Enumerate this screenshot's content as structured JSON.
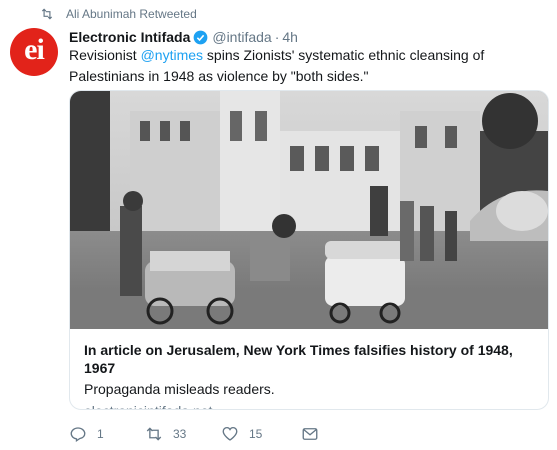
{
  "retweet_context": {
    "text": "Ali Abunimah Retweeted",
    "icon": "retweet-icon"
  },
  "author": {
    "avatar_text": "ei",
    "avatar_color": "#e2231a",
    "name": "Electronic Intifada",
    "verified": true,
    "handle": "@intifada",
    "separator": "·",
    "time": "4h"
  },
  "tweet": {
    "text_before": "Revisionist ",
    "mention": "@nytimes",
    "text_after": " spins Zionists' systematic ethnic cleansing of Palestinians in 1948 as violence by \"both sides.\""
  },
  "card": {
    "image": "black-and-white photo of a street scene with people pushing carts and prams",
    "title": "In article on Jerusalem, New York Times falsifies history of 1948, 1967",
    "description": "Propaganda misleads readers.",
    "url": "electronicintifada.net"
  },
  "actions": {
    "reply_count": "1",
    "retweet_count": "33",
    "like_count": "15"
  },
  "colors": {
    "link": "#1da1f2",
    "secondary_text": "#657786",
    "border": "#e1e8ed"
  }
}
